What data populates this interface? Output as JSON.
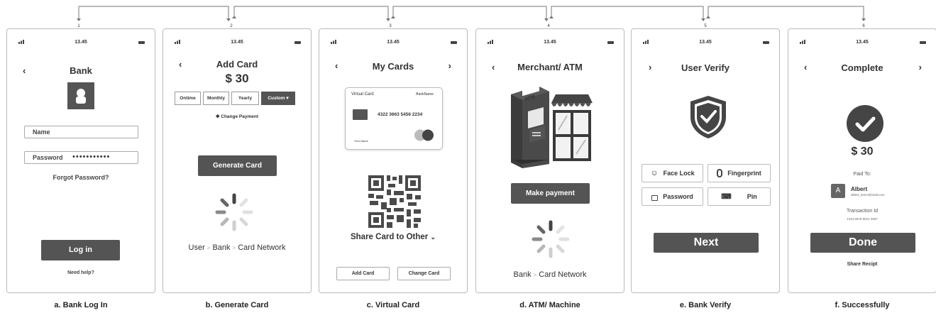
{
  "steps": [
    "1",
    "2",
    "3",
    "4",
    "5",
    "6"
  ],
  "screens": {
    "a": {
      "time": "13.45",
      "title": "Bank",
      "name_label": "Name",
      "password_label": "Password",
      "password_value": "•••••••••••",
      "forgot": "Forgot Password?",
      "login": "Log in",
      "help": "Need help?",
      "caption": "a. Bank Log In"
    },
    "b": {
      "time": "13.45",
      "title": "Add Card",
      "amount": "$ 30",
      "options": [
        "Ontime",
        "Monthly",
        "Yearly",
        "Custom ▾"
      ],
      "change_payment": "Change Payment",
      "generate": "Generate Card",
      "flow": [
        "User",
        "Bank",
        "Card Network"
      ],
      "caption": "b.  Generate Card"
    },
    "c": {
      "time": "13.45",
      "title": "My Cards",
      "card_label": "Virtual Card",
      "bank_name": "BankName",
      "card_number": "4322 3663 5456 2234",
      "holder": "Your Name",
      "share": "Share Card to Other",
      "add_card": "Add Card",
      "change_card": "Change Card",
      "caption": "c.  Virtual Card"
    },
    "d": {
      "time": "13.45",
      "title": "Merchant/ ATM",
      "atm_label": "ATM",
      "pay": "Make payment",
      "flow": [
        "Bank",
        "Card Network"
      ],
      "caption": "d. ATM/ Machine"
    },
    "e": {
      "time": "13.45",
      "title": "User Verify",
      "face": "Face Lock",
      "finger": "Fingerprint",
      "password": "Password",
      "pin": "Pin",
      "next": "Next",
      "caption": "e.  Bank Verify"
    },
    "f": {
      "time": "13.45",
      "title": "Complete",
      "amount": "$ 30",
      "paid_to": "Paid To:",
      "avatar": "A",
      "payee": "Albert",
      "payee_email": "albert_tomm@mail.com",
      "tx_label": "Transaction Id",
      "tx_id": "1234 5678 9012 4567",
      "done": "Done",
      "share": "Share Recipt",
      "caption": "f.  Successfully"
    }
  },
  "colors": {
    "dark": "#545454",
    "border": "#bbbbbb",
    "text": "#333333"
  }
}
